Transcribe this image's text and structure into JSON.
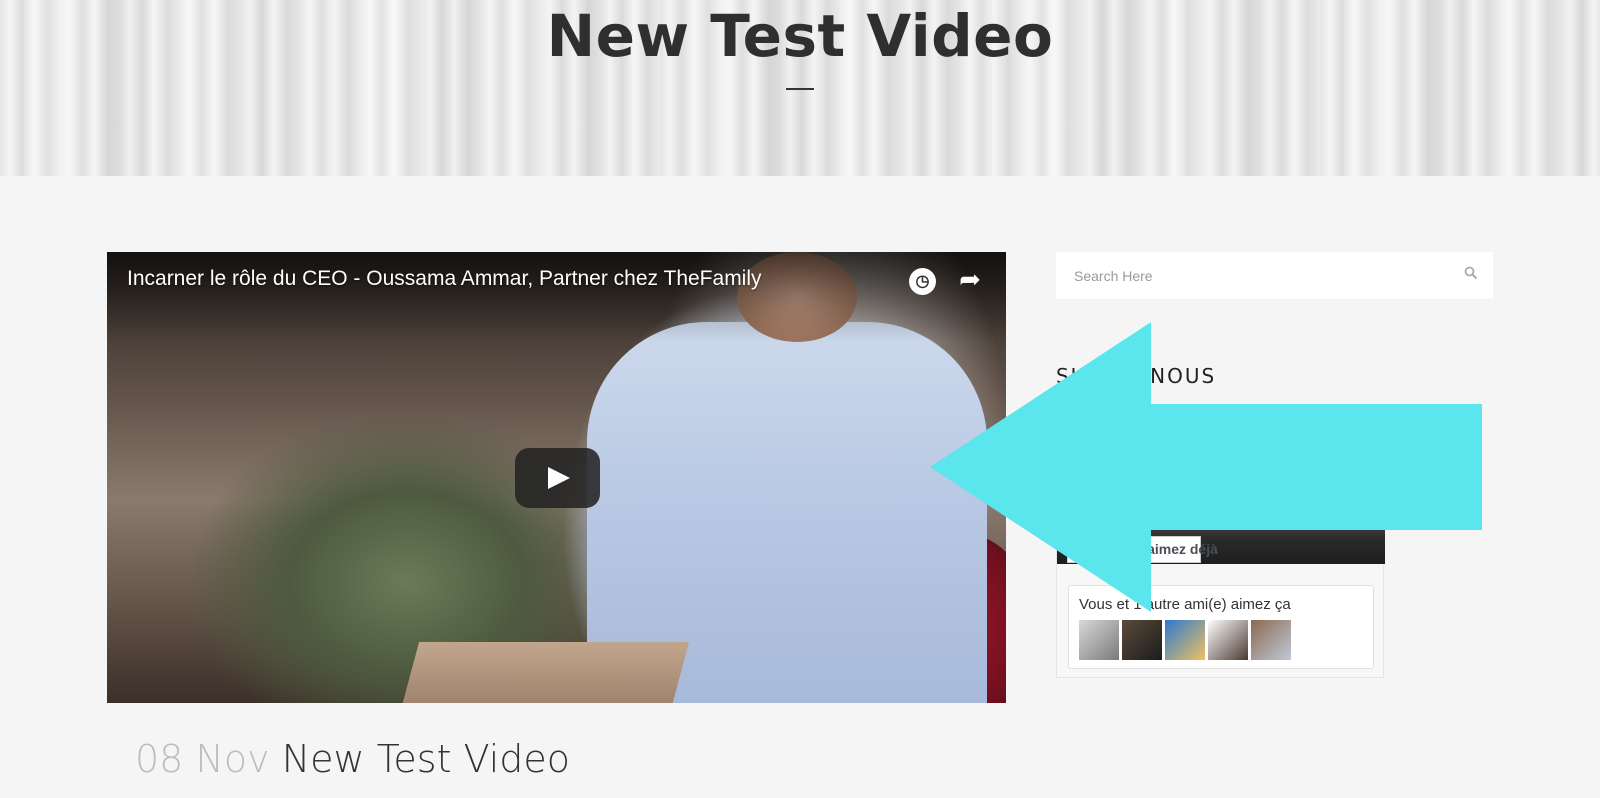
{
  "hero": {
    "title": "New Test Video"
  },
  "video": {
    "title": "Incarner le rôle du CEO - Oussama Ammar, Partner chez TheFamily",
    "icons": {
      "watch_later": "clock-icon",
      "share": "share-arrow-icon",
      "play": "play-icon"
    }
  },
  "post": {
    "date": "08 Nov",
    "title": "New Test Video"
  },
  "sidebar": {
    "search": {
      "placeholder": "Search Here",
      "icon": "search-icon"
    },
    "widget_title": "SUIVEZ-NOUS",
    "facebook": {
      "like_label": "Vous aimez déjà",
      "friends_text": "Vous et 1 autre ami(e) aimez ça",
      "avatar_count": 5
    }
  },
  "annotation": {
    "arrow_color": "#5ae6ec",
    "direction": "left"
  }
}
